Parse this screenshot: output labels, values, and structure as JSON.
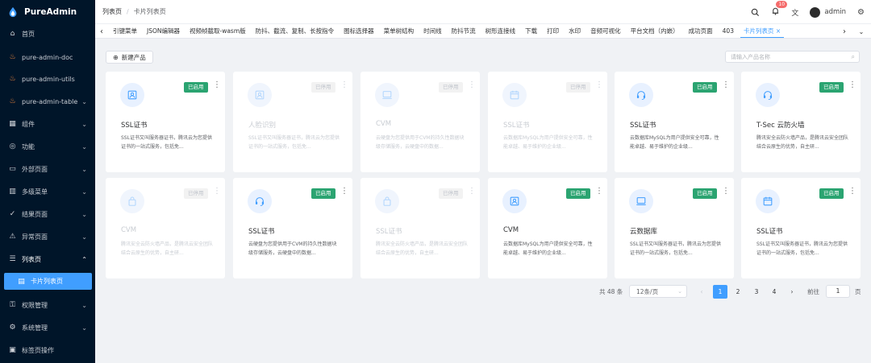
{
  "app": {
    "name": "PureAdmin",
    "colors": {
      "accent": "#409eff",
      "sidebar": "#001529",
      "success": "#2ba471"
    }
  },
  "sidebar": {
    "items": [
      {
        "label": "首页",
        "icon": "home-icon",
        "chevron": ""
      },
      {
        "label": "pure-admin-doc",
        "icon": "flame-icon",
        "chevron": ""
      },
      {
        "label": "pure-admin-utils",
        "icon": "flame-icon",
        "chevron": ""
      },
      {
        "label": "pure-admin-table",
        "icon": "flame-icon",
        "chevron": "⌄"
      },
      {
        "label": "组件",
        "icon": "grid-icon",
        "chevron": "⌄"
      },
      {
        "label": "功能",
        "icon": "target-icon",
        "chevron": "⌄"
      },
      {
        "label": "外部页面",
        "icon": "window-icon",
        "chevron": "⌄"
      },
      {
        "label": "多级菜单",
        "icon": "bars-icon",
        "chevron": "⌄"
      },
      {
        "label": "结果页面",
        "icon": "check-circle-icon",
        "chevron": "⌄"
      },
      {
        "label": "异常页面",
        "icon": "warning-icon",
        "chevron": "⌄"
      },
      {
        "label": "列表页",
        "icon": "list-icon",
        "chevron": "⌃"
      },
      {
        "label": "卡片列表页",
        "icon": "card-icon",
        "chevron": ""
      },
      {
        "label": "权限管理",
        "icon": "key-icon",
        "chevron": "⌄"
      },
      {
        "label": "系统管理",
        "icon": "settings-icon",
        "chevron": "⌄"
      },
      {
        "label": "标签页操作",
        "icon": "tag-page-icon",
        "chevron": ""
      }
    ]
  },
  "header": {
    "breadcrumb": [
      "列表页",
      "卡片列表页"
    ],
    "breadcrumb_sep": "/",
    "notification_count": "10",
    "username": "admin"
  },
  "tags": {
    "items": [
      "引键菜单",
      "JSON编辑器",
      "视频帧截取-wasm版",
      "防抖、截流、复制、长按指令",
      "图标选择器",
      "菜单树结构",
      "时间线",
      "防抖节流",
      "树形连接线",
      "下载",
      "打印",
      "水印",
      "音频可视化",
      "平台文档（内嵌）",
      "成功页面",
      "403",
      "卡片列表页 ×"
    ],
    "active_index": 16
  },
  "main": {
    "new_button_label": "新建产品",
    "search_placeholder": "请输入产品名称"
  },
  "cards": [
    {
      "title": "SSL证书",
      "desc": "SSL证书又叫服务器证书，腾讯云为您提供证书的一站式服务，包括免...",
      "status": "已启用",
      "enabled": true,
      "icon": "certificate-icon"
    },
    {
      "title": "人脸识别",
      "desc": "SSL证书又叫服务器证书，腾讯云为您提供证书的一站式服务，包括免...",
      "status": "已停用",
      "enabled": false,
      "icon": "certificate-icon"
    },
    {
      "title": "CVM",
      "desc": "云硬盘为您提供用于CVM的持久性数据块级存储服务，云硬盘中的数据...",
      "status": "已停用",
      "enabled": false,
      "icon": "monitor-icon"
    },
    {
      "title": "SSL证书",
      "desc": "云数据库MySQL为用户提供安全可靠，性能卓越、易于维护的企业级...",
      "status": "已停用",
      "enabled": false,
      "icon": "calendar-icon"
    },
    {
      "title": "SSL证书",
      "desc": "云数据库MySQL为用户提供安全可靠，性能卓越、易于维护的企业级...",
      "status": "已启用",
      "enabled": true,
      "icon": "headset-icon"
    },
    {
      "title": "T-Sec 云防火墙",
      "desc": "腾讯安全云防火墙产品，是腾讯云安全团队结合云原生的优势，自主研...",
      "status": "已启用",
      "enabled": true,
      "icon": "headset-icon"
    },
    {
      "title": "CVM",
      "desc": "腾讯安全云防火墙产品，是腾讯云安全团队结合云原生的优势，自主研...",
      "status": "已停用",
      "enabled": false,
      "icon": "bag-icon"
    },
    {
      "title": "SSL证书",
      "desc": "云硬盘为您提供用于CVM的持久性数据块级存储服务，云硬盘中的数据...",
      "status": "已启用",
      "enabled": true,
      "icon": "headset-icon"
    },
    {
      "title": "SSL证书",
      "desc": "腾讯安全云防火墙产品，是腾讯云安全团队结合云原生的优势，自主研...",
      "status": "已停用",
      "enabled": false,
      "icon": "bag-icon"
    },
    {
      "title": "CVM",
      "desc": "云数据库MySQL为用户提供安全可靠，性能卓越、易于维护的企业级...",
      "status": "已启用",
      "enabled": true,
      "icon": "certificate-icon"
    },
    {
      "title": "云数据库",
      "desc": "SSL证书又叫服务器证书，腾讯云为您提供证书的一站式服务，包括免...",
      "status": "已启用",
      "enabled": true,
      "icon": "monitor-icon"
    },
    {
      "title": "SSL证书",
      "desc": "SSL证书又叫服务器证书，腾讯云为您提供证书的一站式服务，包括免...",
      "status": "已启用",
      "enabled": true,
      "icon": "calendar-icon"
    }
  ],
  "pagination": {
    "total_label": "共 48 条",
    "page_size_label": "12条/页",
    "pages": [
      "1",
      "2",
      "3",
      "4"
    ],
    "current_page": "1",
    "prev": "‹",
    "next": "›",
    "goto_label": "前往",
    "goto_value": "1",
    "page_unit": "页"
  }
}
